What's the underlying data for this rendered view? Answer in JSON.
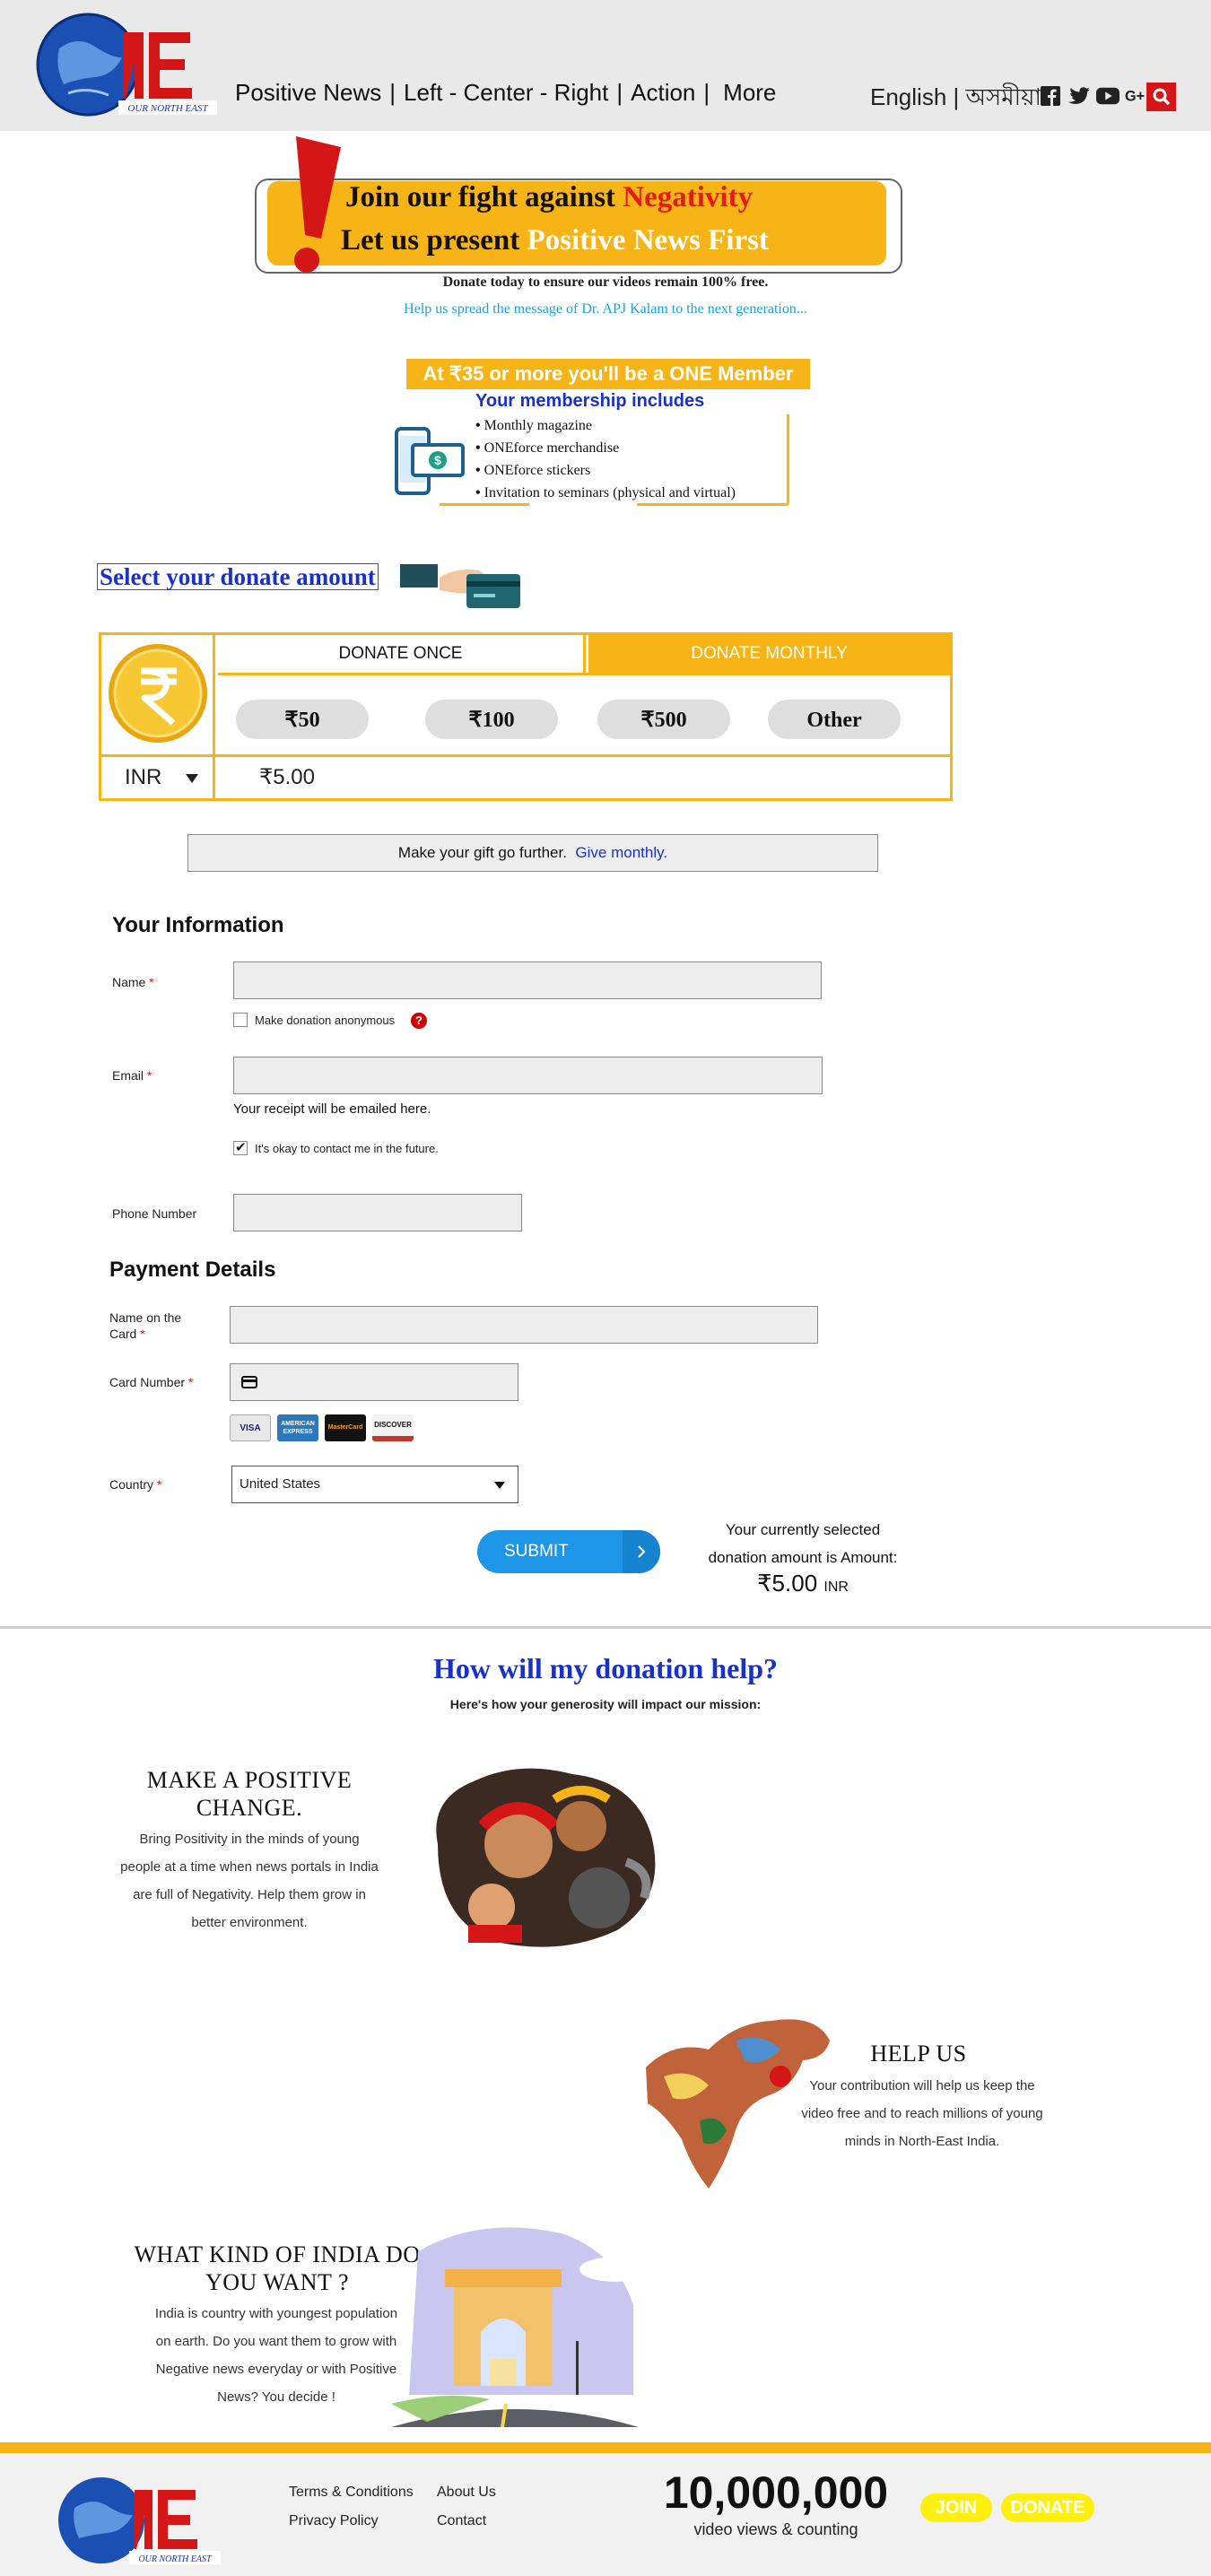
{
  "header": {
    "logo_text": "OUR NORTH EAST",
    "nav": [
      "Positive News",
      "Left - Center - Right",
      "Action",
      "More"
    ],
    "nav_sep": "|",
    "lang_english": "English",
    "lang_sep": "|",
    "lang_assamese": "অসমীয়া",
    "social_icons": [
      "facebook-icon",
      "twitter-icon",
      "youtube-icon",
      "google-plus-icon"
    ],
    "search_icon": "search-icon"
  },
  "hero": {
    "banner_line1_a": "Join our fight against ",
    "banner_line1_b": "Negativity",
    "banner_line2_a": "Let us present ",
    "banner_line2_b": "Positive News First",
    "sub1": "Donate today to ensure our videos remain 100% free.",
    "sub2": "Help us spread the message of Dr. APJ Kalam to the next generation..."
  },
  "membership": {
    "pill": "At ₹35 or more you'll be a ONE Member",
    "title": "Your membership includes",
    "items": [
      "Monthly magazine",
      "ONEforce merchandise",
      "ONEforce stickers",
      "Invitation to seminars (physical and virtual)"
    ]
  },
  "donate": {
    "select_label": "Select your donate amount",
    "tab_once": "DONATE ONCE",
    "tab_monthly": "DONATE MONTHLY",
    "amounts": [
      "₹50",
      "₹100",
      "₹500",
      "Other"
    ],
    "currency": "INR",
    "amount_value": "₹5.00",
    "gift_text": "Make your gift go further.",
    "gift_link": "Give monthly."
  },
  "info": {
    "title": "Your Information",
    "name_label": "Name",
    "required_mark": "*",
    "anonymous_label": "Make donation anonymous",
    "help_glyph": "?",
    "email_label": "Email",
    "email_note": "Your receipt will be emailed here.",
    "contact_label": "It's okay to contact me in the future.",
    "phone_label": "Phone Number"
  },
  "payment": {
    "title": "Payment Details",
    "card_name_label_1": "Name on the",
    "card_name_label_2": "Card",
    "card_number_label": "Card Number",
    "cards": [
      "VISA",
      "AMERICAN EXPRESS",
      "MasterCard",
      "DISCOVER"
    ],
    "country_label": "Country",
    "country_value": "United States",
    "submit": "SUBMIT",
    "selected_text_1": "Your currently selected",
    "selected_text_2": "donation amount is Amount:",
    "selected_amount": "₹5.00",
    "selected_currency": "INR"
  },
  "impact": {
    "title": "How will my donation help?",
    "subtitle": "Here's how your generosity will impact our mission:",
    "blocks": [
      {
        "title_1": "MAKE A POSITIVE",
        "title_2": "CHANGE.",
        "lines": [
          "Bring Positivity in the minds of young",
          "people at a time when news portals in India",
          "are full of Negativity. Help them grow in",
          "better environment."
        ]
      },
      {
        "title_1": "HELP US",
        "lines": [
          "Your contribution will help us keep the",
          "video free and  to reach millions of young",
          "minds in North-East India."
        ]
      },
      {
        "title_1": "WHAT KIND OF INDIA DO",
        "title_2": "YOU WANT ?",
        "lines": [
          "India is country with youngest population",
          "on earth. Do you want them to grow with",
          "Negative news everyday or with Positive",
          "News? You decide !"
        ]
      }
    ]
  },
  "footer": {
    "logo_text": "OUR NORTH EAST",
    "links": [
      "Terms & Conditions",
      "About Us",
      "Privacy Policy",
      "Contact"
    ],
    "count": "10,000,000",
    "count_label": "video views & counting",
    "join": "JOIN",
    "donate": "DONATE"
  },
  "colors": {
    "accent": "#f7b417",
    "brand_red": "#d41616",
    "link_blue": "#1a31c8",
    "submit_blue": "#1e96e8"
  }
}
